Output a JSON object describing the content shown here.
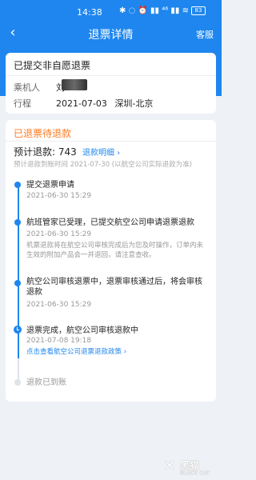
{
  "status_bar": {
    "time": "14:38",
    "icons": "✱ ◌ ⏰ ▮▮ ⁴⁶ ▮▮ ≋",
    "battery": "83"
  },
  "nav": {
    "back_icon": "‹",
    "title": "退票详情",
    "service": "客服"
  },
  "order": {
    "title": "已提交非自愿退票",
    "passenger_label": "乘机人",
    "passenger_value": "刘",
    "route_label": "行程",
    "date": "2021-07-03",
    "route": "深圳-北京"
  },
  "refund": {
    "status_title": "已退票待退款",
    "estimate_label": "预计退款: 743",
    "detail_link": "退款明细 ›",
    "note": "预计退款到账时间 2021-07-30 (以航空公司实际退款为准)"
  },
  "timeline": {
    "step1": {
      "title": "提交退票申请",
      "time": "2021-06-30 15:29"
    },
    "step2": {
      "title": "航班管家已受理，已提交航空公司申请退票退款",
      "time": "2021-06-30 15:29",
      "note": "机票退款将在航空公司审核完成后为您及时操作，订单内未生效的附加产品会一并退回，请注意查收。"
    },
    "step3": {
      "title": "航空公司审核退票中，退票审核通过后，将会审核退款",
      "time": "2021-06-30 15:29"
    },
    "step4": {
      "title": "退票完成，航空公司审核退款中",
      "time": "2021-07-08 19:18",
      "link": "点击查看航空公司退票退款政策 ›"
    },
    "step5": {
      "title": "退款已到账"
    }
  },
  "watermark": {
    "icon": "✕",
    "text": "黑猫",
    "sub": "BLACK CAT"
  },
  "colors": {
    "primary": "#1e86ee",
    "status_orange": "#ff7a20",
    "background": "#eef1f5"
  }
}
